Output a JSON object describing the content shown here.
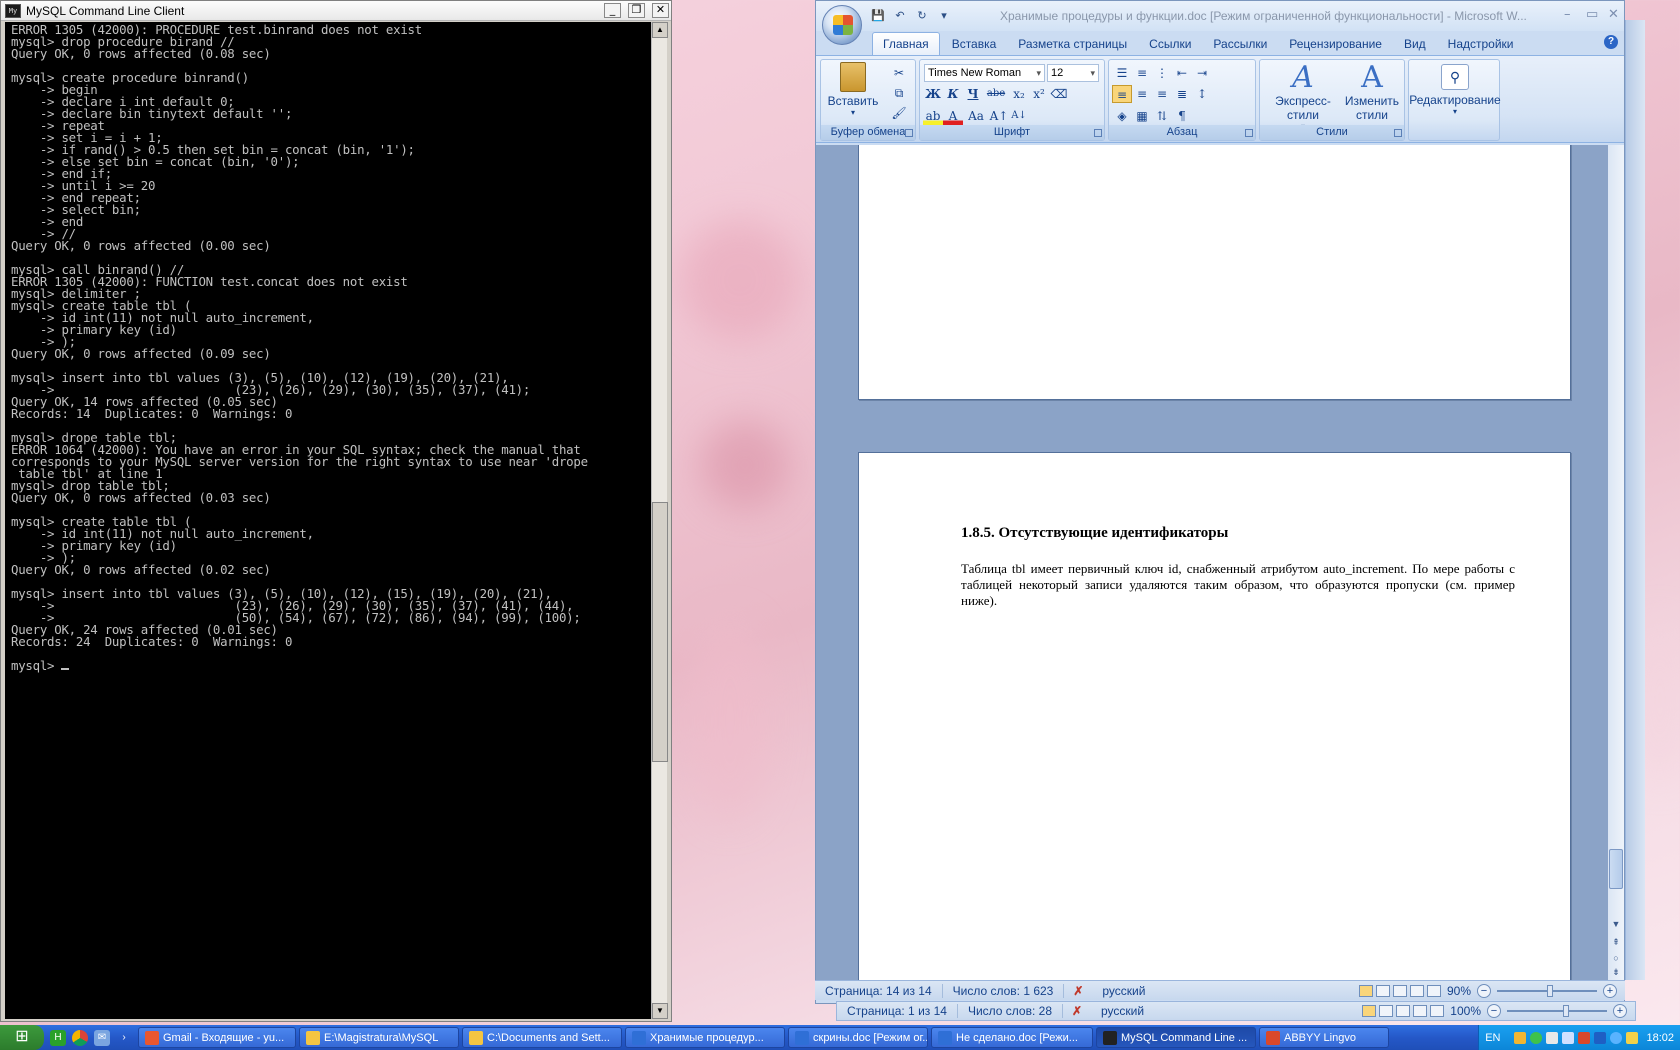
{
  "console": {
    "title": "MySQL Command Line Client",
    "lines": [
      "ERROR 1305 (42000): PROCEDURE test.binrand does not exist",
      "mysql> drop procedure birand //",
      "Query OK, 0 rows affected (0.08 sec)",
      "",
      "mysql> create procedure binrand()",
      "    -> begin",
      "    -> declare i int default 0;",
      "    -> declare bin tinytext default '';",
      "    -> repeat",
      "    -> set i = i + 1;",
      "    -> if rand() > 0.5 then set bin = concat (bin, '1');",
      "    -> else set bin = concat (bin, '0');",
      "    -> end if;",
      "    -> until i >= 20",
      "    -> end repeat;",
      "    -> select bin;",
      "    -> end",
      "    -> //",
      "Query OK, 0 rows affected (0.00 sec)",
      "",
      "mysql> call binrand() //",
      "ERROR 1305 (42000): FUNCTION test.concat does not exist",
      "mysql> delimiter ;",
      "mysql> create table tbl (",
      "    -> id int(11) not null auto_increment,",
      "    -> primary key (id)",
      "    -> );",
      "Query OK, 0 rows affected (0.09 sec)",
      "",
      "mysql> insert into tbl values (3), (5), (10), (12), (19), (20), (21),",
      "    ->                         (23), (26), (29), (30), (35), (37), (41);",
      "Query OK, 14 rows affected (0.05 sec)",
      "Records: 14  Duplicates: 0  Warnings: 0",
      "",
      "mysql> drope table tbl;",
      "ERROR 1064 (42000): You have an error in your SQL syntax; check the manual that",
      "corresponds to your MySQL server version for the right syntax to use near 'drope",
      " table tbl' at line 1",
      "mysql> drop table tbl;",
      "Query OK, 0 rows affected (0.03 sec)",
      "",
      "mysql> create table tbl (",
      "    -> id int(11) not null auto_increment,",
      "    -> primary key (id)",
      "    -> );",
      "Query OK, 0 rows affected (0.02 sec)",
      "",
      "mysql> insert into tbl values (3), (5), (10), (12), (15), (19), (20), (21),",
      "    ->                         (23), (26), (29), (30), (35), (37), (41), (44),",
      "    ->                         (50), (54), (67), (72), (86), (94), (99), (100);",
      "Query OK, 24 rows affected (0.01 sec)",
      "Records: 24  Duplicates: 0  Warnings: 0",
      ""
    ],
    "prompt": "mysql> "
  },
  "word": {
    "title": "Хранимые процедуры и функции.doc [Режим ограниченной функциональности] - Microsoft W...",
    "tabs": [
      "Главная",
      "Вставка",
      "Разметка страницы",
      "Ссылки",
      "Рассылки",
      "Рецензирование",
      "Вид",
      "Надстройки"
    ],
    "ribbon": {
      "clipboard": {
        "paste": "Вставить",
        "label": "Буфер обмена"
      },
      "font": {
        "name": "Times New Roman",
        "size": "12",
        "label": "Шрифт",
        "bold": "Ж",
        "italic": "К",
        "underline": "Ч",
        "strike": "abe",
        "sub": "x₂",
        "sup": "x²",
        "case": "Aa"
      },
      "paragraph": {
        "label": "Абзац"
      },
      "styles": {
        "express": "Экспресс-стили",
        "change_1": "Изменить",
        "change_2": "стили",
        "label": "Стили"
      },
      "editing": {
        "label": "Редактирование"
      }
    },
    "document": {
      "heading": "1.8.5. Отсутствующие идентификаторы",
      "paragraph": "Таблица tbl имеет первичный ключ id, снабженный атрибутом auto_increment. По мере работы с таблицей некоторый записи удаляются таким образом, что образуются пропуски (см. пример ниже)."
    },
    "status_main": {
      "page": "Страница: 14 из 14",
      "words": "Число слов: 1 623",
      "lang": "русский",
      "zoom": "90%"
    },
    "status_back": {
      "page": "Страница: 1 из 14",
      "words": "Число слов: 28",
      "lang": "русский",
      "zoom": "100%"
    }
  },
  "taskbar": {
    "items": [
      {
        "label": "Gmail - Входящие - yu...",
        "color": "#e8572f"
      },
      {
        "label": "E:\\Magistratura\\MySQL",
        "color": "#f4c542"
      },
      {
        "label": "C:\\Documents and Sett...",
        "color": "#f4c542"
      },
      {
        "label": "Хранимые процедур...",
        "color": "#2f6fd6"
      },
      {
        "label": "скрины.doc [Режим ог...",
        "color": "#2f6fd6"
      },
      {
        "label": "Не сделано.doc [Режи...",
        "color": "#2f6fd6"
      },
      {
        "label": "MySQL Command Line ...",
        "color": "#222222"
      },
      {
        "label": "ABBYY Lingvo",
        "color": "#d9482b"
      }
    ],
    "lang": "EN",
    "clock": "18:02"
  }
}
